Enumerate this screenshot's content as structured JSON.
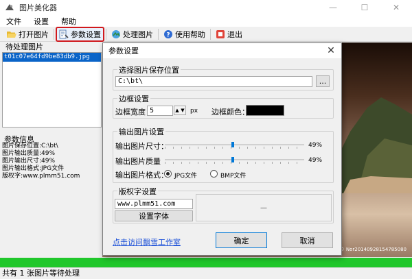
{
  "window": {
    "title": "图片美化器"
  },
  "menu": {
    "items": [
      "文件",
      "设置",
      "帮助"
    ]
  },
  "toolbar": {
    "open": "打开图片",
    "params": "参数设置",
    "process": "处理图片",
    "help": "使用帮助",
    "exit": "退出"
  },
  "left": {
    "list_title": "待处理图片",
    "files": [
      "t01c07e64fd9be83db9.jpg"
    ],
    "info_title": "参数信息",
    "info_lines": [
      "图片保存位置:C:\\bt\\",
      "图片输出质量:49%",
      "图片输出尺寸:49%",
      "图片输出格式:JPG文件",
      "版权字:www.plmm51.com"
    ]
  },
  "image": {
    "watermark": "© Nor20140928154785080"
  },
  "status": {
    "text": "共有 1 张图片等待处理",
    "progress": 1.0
  },
  "dialog": {
    "title": "参数设置",
    "save": {
      "label": "选择图片保存位置",
      "path": "C:\\bt\\",
      "browse": "..."
    },
    "border": {
      "label": "边框设置",
      "width_label": "边框宽度：",
      "width_value": "5",
      "unit": "px",
      "color_label": "边框颜色：",
      "color": "#000000"
    },
    "output": {
      "label": "输出图片设置",
      "size_label": "输出图片尺寸：",
      "size_value": 49,
      "size_text": "49%",
      "quality_label": "输出图片质量",
      "quality_value": 49,
      "quality_text": "49%",
      "format_label": "输出图片格式：",
      "format_jpg": "JPG文件",
      "format_bmp": "BMP文件",
      "format_selected": "JPG文件"
    },
    "copyright": {
      "label": "版权字设置",
      "text": "www.plmm51.com",
      "font_button": "设置字体",
      "preview": "—"
    },
    "link": "点击访问飘雪工作室",
    "ok": "确定",
    "cancel": "取消"
  }
}
